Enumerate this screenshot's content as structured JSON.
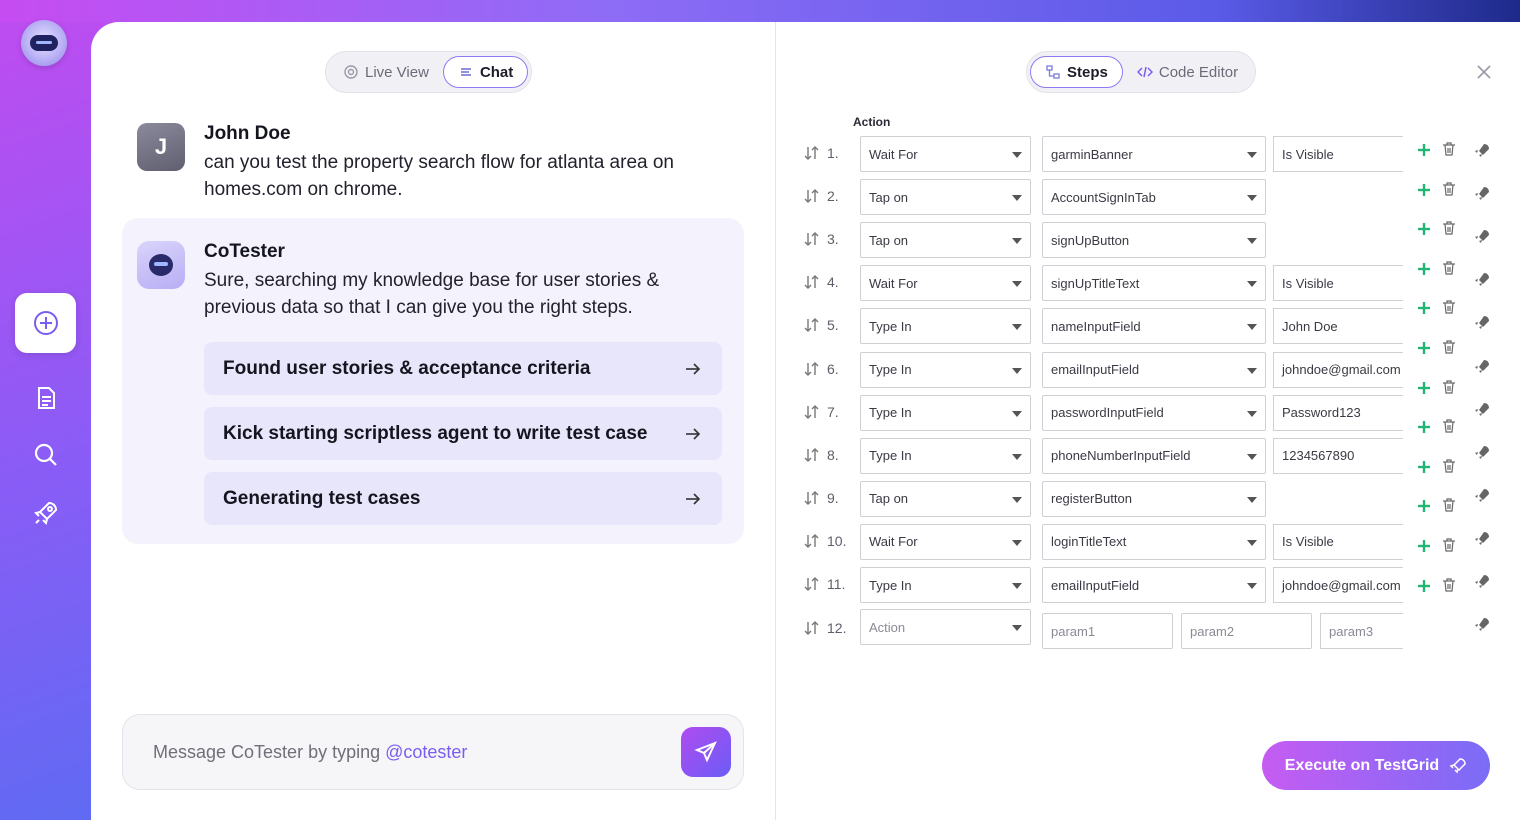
{
  "left_tabs": {
    "live_view": "Live View",
    "chat": "Chat"
  },
  "right_tabs": {
    "steps": "Steps",
    "code_editor": "Code Editor"
  },
  "chat": {
    "user": {
      "initial": "J",
      "name": "John Doe",
      "line1": "can you test the property search flow for atlanta area on",
      "line2": "homes.com on chrome."
    },
    "bot": {
      "name": "CoTester",
      "line1": "Sure, searching my knowledge base for user stories &",
      "line2": "previous data so that I can give you the right steps.",
      "steps": [
        "Found user stories & acceptance criteria",
        "Kick starting scriptless agent to write test case",
        "Generating test cases"
      ]
    },
    "composer": {
      "placeholder": "Message CoTester by typing ",
      "mention": "@cotester"
    }
  },
  "steps_panel": {
    "column_header": "Action",
    "rows": [
      {
        "num": "1.",
        "action": "Wait For",
        "target": "garminBanner",
        "value": "Is Visible"
      },
      {
        "num": "2.",
        "action": "Tap on",
        "target": "AccountSignInTab",
        "value": ""
      },
      {
        "num": "3.",
        "action": "Tap on",
        "target": "signUpButton",
        "value": ""
      },
      {
        "num": "4.",
        "action": "Wait For",
        "target": "signUpTitleText",
        "value": "Is Visible"
      },
      {
        "num": "5.",
        "action": "Type In",
        "target": "nameInputField",
        "value": "John Doe"
      },
      {
        "num": "6.",
        "action": "Type In",
        "target": "emailInputField",
        "value": "johndoe@gmail.com"
      },
      {
        "num": "7.",
        "action": "Type In",
        "target": "passwordInputField",
        "value": "Password123"
      },
      {
        "num": "8.",
        "action": "Type In",
        "target": "phoneNumberInputField",
        "value": "1234567890"
      },
      {
        "num": "9.",
        "action": "Tap on",
        "target": "registerButton",
        "value": ""
      },
      {
        "num": "10.",
        "action": "Wait For",
        "target": "loginTitleText",
        "value": "Is Visible"
      },
      {
        "num": "11.",
        "action": "Type In",
        "target": "emailInputField",
        "value": "johndoe@gmail.com"
      }
    ],
    "new_row": {
      "num": "12.",
      "action_placeholder": "Action",
      "param1": "param1",
      "param2": "param2",
      "param3": "param3"
    },
    "execute_label": "Execute on TestGrid"
  },
  "colors": {
    "accent": "#8b7cf6",
    "plus": "#22b573",
    "brand_gradient_start": "#c65cf2",
    "brand_gradient_end": "#7a6cf6"
  }
}
